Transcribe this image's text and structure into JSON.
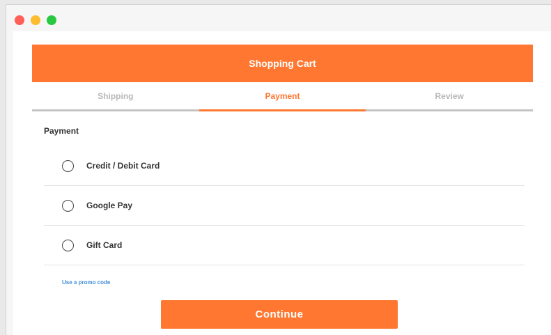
{
  "colors": {
    "accent": "#ff7730",
    "link": "#3f8fd6",
    "tab_inactive": "#b8b8b8"
  },
  "window": {
    "controls": [
      "close",
      "minimize",
      "zoom"
    ]
  },
  "header": {
    "title": "Shopping Cart"
  },
  "tabs": [
    {
      "label": "Shipping",
      "active": false
    },
    {
      "label": "Payment",
      "active": true
    },
    {
      "label": "Review",
      "active": false
    }
  ],
  "payment": {
    "title": "Payment",
    "options": [
      {
        "label": "Credit / Debit Card",
        "selected": false
      },
      {
        "label": "Google Pay",
        "selected": false
      },
      {
        "label": "Gift Card",
        "selected": false
      }
    ],
    "promo_link": "Use a promo code"
  },
  "actions": {
    "continue_label": "Continue"
  }
}
